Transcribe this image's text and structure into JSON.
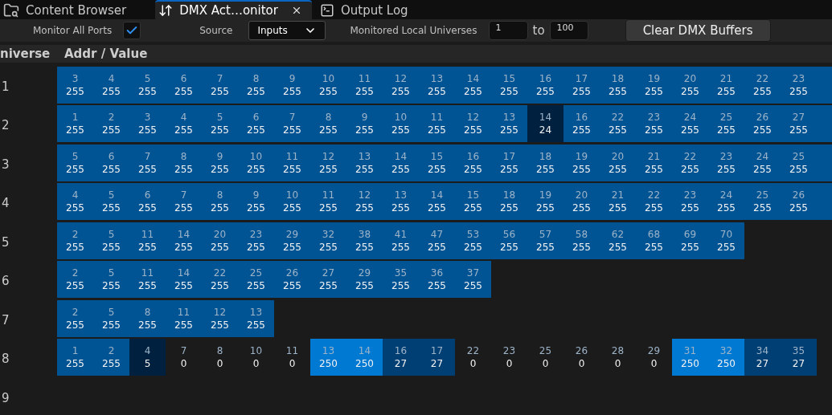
{
  "tabs": [
    {
      "kind": "browser",
      "label": "Content Browser",
      "selected": false,
      "closable": false
    },
    {
      "kind": "monitor",
      "label": "DMX Act…onitor",
      "selected": true,
      "closable": true
    },
    {
      "kind": "log",
      "label": "Output Log",
      "selected": false,
      "closable": false
    }
  ],
  "toolbar": {
    "monitor_all_ports": {
      "label": "Monitor All Ports",
      "checked": true
    },
    "source": {
      "label": "Source",
      "value": "Inputs"
    },
    "universes": {
      "label": "Monitored Local Universes",
      "from": "1",
      "separator": "to",
      "to": "100"
    },
    "clear_button": "Clear DMX Buffers"
  },
  "table": {
    "columns": [
      "niverse",
      "Addr / Value"
    ],
    "rows": [
      {
        "universe": "1",
        "continues": true,
        "cells": [
          {
            "addr": "3",
            "value": "255",
            "color": "#005494"
          },
          {
            "addr": "4",
            "value": "255",
            "color": "#005494"
          },
          {
            "addr": "5",
            "value": "255",
            "color": "#005494"
          },
          {
            "addr": "6",
            "value": "255",
            "color": "#005494"
          },
          {
            "addr": "7",
            "value": "255",
            "color": "#005494"
          },
          {
            "addr": "8",
            "value": "255",
            "color": "#005494"
          },
          {
            "addr": "9",
            "value": "255",
            "color": "#005494"
          },
          {
            "addr": "10",
            "value": "255",
            "color": "#005494"
          },
          {
            "addr": "11",
            "value": "255",
            "color": "#005494"
          },
          {
            "addr": "12",
            "value": "255",
            "color": "#005494"
          },
          {
            "addr": "13",
            "value": "255",
            "color": "#005494"
          },
          {
            "addr": "14",
            "value": "255",
            "color": "#005494"
          },
          {
            "addr": "15",
            "value": "255",
            "color": "#005494"
          },
          {
            "addr": "16",
            "value": "255",
            "color": "#005494"
          },
          {
            "addr": "17",
            "value": "255",
            "color": "#005494"
          },
          {
            "addr": "18",
            "value": "255",
            "color": "#005494"
          },
          {
            "addr": "19",
            "value": "255",
            "color": "#005494"
          },
          {
            "addr": "20",
            "value": "255",
            "color": "#005494"
          },
          {
            "addr": "21",
            "value": "255",
            "color": "#005494"
          },
          {
            "addr": "22",
            "value": "255",
            "color": "#005494"
          },
          {
            "addr": "23",
            "value": "255",
            "color": "#005494"
          }
        ]
      },
      {
        "universe": "2",
        "continues": true,
        "cells": [
          {
            "addr": "1",
            "value": "255",
            "color": "#005494"
          },
          {
            "addr": "2",
            "value": "255",
            "color": "#005494"
          },
          {
            "addr": "3",
            "value": "255",
            "color": "#005494"
          },
          {
            "addr": "4",
            "value": "255",
            "color": "#005494"
          },
          {
            "addr": "5",
            "value": "255",
            "color": "#005494"
          },
          {
            "addr": "6",
            "value": "255",
            "color": "#005494"
          },
          {
            "addr": "7",
            "value": "255",
            "color": "#005494"
          },
          {
            "addr": "8",
            "value": "255",
            "color": "#005494"
          },
          {
            "addr": "9",
            "value": "255",
            "color": "#005494"
          },
          {
            "addr": "10",
            "value": "255",
            "color": "#005494"
          },
          {
            "addr": "11",
            "value": "255",
            "color": "#005494"
          },
          {
            "addr": "12",
            "value": "255",
            "color": "#005494"
          },
          {
            "addr": "13",
            "value": "255",
            "color": "#005494"
          },
          {
            "addr": "14",
            "value": "24",
            "color": "#00203f"
          },
          {
            "addr": "16",
            "value": "255",
            "color": "#005494"
          },
          {
            "addr": "22",
            "value": "255",
            "color": "#005494"
          },
          {
            "addr": "23",
            "value": "255",
            "color": "#005494"
          },
          {
            "addr": "24",
            "value": "255",
            "color": "#005494"
          },
          {
            "addr": "25",
            "value": "255",
            "color": "#005494"
          },
          {
            "addr": "26",
            "value": "255",
            "color": "#005494"
          },
          {
            "addr": "27",
            "value": "255",
            "color": "#005494"
          }
        ]
      },
      {
        "universe": "3",
        "continues": true,
        "cells": [
          {
            "addr": "5",
            "value": "255",
            "color": "#005494"
          },
          {
            "addr": "6",
            "value": "255",
            "color": "#005494"
          },
          {
            "addr": "7",
            "value": "255",
            "color": "#005494"
          },
          {
            "addr": "8",
            "value": "255",
            "color": "#005494"
          },
          {
            "addr": "9",
            "value": "255",
            "color": "#005494"
          },
          {
            "addr": "10",
            "value": "255",
            "color": "#005494"
          },
          {
            "addr": "11",
            "value": "255",
            "color": "#005494"
          },
          {
            "addr": "12",
            "value": "255",
            "color": "#005494"
          },
          {
            "addr": "13",
            "value": "255",
            "color": "#005494"
          },
          {
            "addr": "14",
            "value": "255",
            "color": "#005494"
          },
          {
            "addr": "15",
            "value": "255",
            "color": "#005494"
          },
          {
            "addr": "16",
            "value": "255",
            "color": "#005494"
          },
          {
            "addr": "17",
            "value": "255",
            "color": "#005494"
          },
          {
            "addr": "18",
            "value": "255",
            "color": "#005494"
          },
          {
            "addr": "19",
            "value": "255",
            "color": "#005494"
          },
          {
            "addr": "20",
            "value": "255",
            "color": "#005494"
          },
          {
            "addr": "21",
            "value": "255",
            "color": "#005494"
          },
          {
            "addr": "22",
            "value": "255",
            "color": "#005494"
          },
          {
            "addr": "23",
            "value": "255",
            "color": "#005494"
          },
          {
            "addr": "24",
            "value": "255",
            "color": "#005494"
          },
          {
            "addr": "25",
            "value": "255",
            "color": "#005494"
          }
        ]
      },
      {
        "universe": "4",
        "continues": true,
        "cells": [
          {
            "addr": "4",
            "value": "255",
            "color": "#005494"
          },
          {
            "addr": "5",
            "value": "255",
            "color": "#005494"
          },
          {
            "addr": "6",
            "value": "255",
            "color": "#005494"
          },
          {
            "addr": "7",
            "value": "255",
            "color": "#005494"
          },
          {
            "addr": "8",
            "value": "255",
            "color": "#005494"
          },
          {
            "addr": "9",
            "value": "255",
            "color": "#005494"
          },
          {
            "addr": "10",
            "value": "255",
            "color": "#005494"
          },
          {
            "addr": "11",
            "value": "255",
            "color": "#005494"
          },
          {
            "addr": "12",
            "value": "255",
            "color": "#005494"
          },
          {
            "addr": "13",
            "value": "255",
            "color": "#005494"
          },
          {
            "addr": "14",
            "value": "255",
            "color": "#005494"
          },
          {
            "addr": "15",
            "value": "255",
            "color": "#005494"
          },
          {
            "addr": "18",
            "value": "255",
            "color": "#005494"
          },
          {
            "addr": "19",
            "value": "255",
            "color": "#005494"
          },
          {
            "addr": "20",
            "value": "255",
            "color": "#005494"
          },
          {
            "addr": "21",
            "value": "255",
            "color": "#005494"
          },
          {
            "addr": "22",
            "value": "255",
            "color": "#005494"
          },
          {
            "addr": "23",
            "value": "255",
            "color": "#005494"
          },
          {
            "addr": "24",
            "value": "255",
            "color": "#005494"
          },
          {
            "addr": "25",
            "value": "255",
            "color": "#005494"
          },
          {
            "addr": "26",
            "value": "255",
            "color": "#005494"
          }
        ]
      },
      {
        "universe": "5",
        "continues": false,
        "cells": [
          {
            "addr": "2",
            "value": "255",
            "color": "#005494"
          },
          {
            "addr": "5",
            "value": "255",
            "color": "#005494"
          },
          {
            "addr": "11",
            "value": "255",
            "color": "#005494"
          },
          {
            "addr": "14",
            "value": "255",
            "color": "#005494"
          },
          {
            "addr": "20",
            "value": "255",
            "color": "#005494"
          },
          {
            "addr": "23",
            "value": "255",
            "color": "#005494"
          },
          {
            "addr": "29",
            "value": "255",
            "color": "#005494"
          },
          {
            "addr": "32",
            "value": "255",
            "color": "#005494"
          },
          {
            "addr": "38",
            "value": "255",
            "color": "#005494"
          },
          {
            "addr": "41",
            "value": "255",
            "color": "#005494"
          },
          {
            "addr": "47",
            "value": "255",
            "color": "#005494"
          },
          {
            "addr": "53",
            "value": "255",
            "color": "#005494"
          },
          {
            "addr": "56",
            "value": "255",
            "color": "#005494"
          },
          {
            "addr": "57",
            "value": "255",
            "color": "#005494"
          },
          {
            "addr": "58",
            "value": "255",
            "color": "#005494"
          },
          {
            "addr": "62",
            "value": "255",
            "color": "#005494"
          },
          {
            "addr": "68",
            "value": "255",
            "color": "#005494"
          },
          {
            "addr": "69",
            "value": "255",
            "color": "#005494"
          },
          {
            "addr": "70",
            "value": "255",
            "color": "#005494"
          }
        ]
      },
      {
        "universe": "6",
        "continues": false,
        "cells": [
          {
            "addr": "2",
            "value": "255",
            "color": "#005494"
          },
          {
            "addr": "5",
            "value": "255",
            "color": "#005494"
          },
          {
            "addr": "11",
            "value": "255",
            "color": "#005494"
          },
          {
            "addr": "14",
            "value": "255",
            "color": "#005494"
          },
          {
            "addr": "22",
            "value": "255",
            "color": "#005494"
          },
          {
            "addr": "25",
            "value": "255",
            "color": "#005494"
          },
          {
            "addr": "26",
            "value": "255",
            "color": "#005494"
          },
          {
            "addr": "27",
            "value": "255",
            "color": "#005494"
          },
          {
            "addr": "29",
            "value": "255",
            "color": "#005494"
          },
          {
            "addr": "35",
            "value": "255",
            "color": "#005494"
          },
          {
            "addr": "36",
            "value": "255",
            "color": "#005494"
          },
          {
            "addr": "37",
            "value": "255",
            "color": "#005494"
          }
        ]
      },
      {
        "universe": "7",
        "continues": false,
        "cells": [
          {
            "addr": "2",
            "value": "255",
            "color": "#005494"
          },
          {
            "addr": "5",
            "value": "255",
            "color": "#005494"
          },
          {
            "addr": "8",
            "value": "255",
            "color": "#005494"
          },
          {
            "addr": "11",
            "value": "255",
            "color": "#005494"
          },
          {
            "addr": "12",
            "value": "255",
            "color": "#005494"
          },
          {
            "addr": "13",
            "value": "255",
            "color": "#005494"
          }
        ]
      },
      {
        "universe": "8",
        "continues": false,
        "cells": [
          {
            "addr": "1",
            "value": "255",
            "color": "#005494"
          },
          {
            "addr": "2",
            "value": "255",
            "color": "#005494"
          },
          {
            "addr": "4",
            "value": "5",
            "color": "#00203f"
          },
          {
            "addr": "7",
            "value": "0",
            "color": "#1b1b1b"
          },
          {
            "addr": "8",
            "value": "0",
            "color": "#1b1b1b"
          },
          {
            "addr": "10",
            "value": "0",
            "color": "#1b1b1b"
          },
          {
            "addr": "11",
            "value": "0",
            "color": "#1b1b1b"
          },
          {
            "addr": "13",
            "value": "250",
            "color": "#0079d3"
          },
          {
            "addr": "14",
            "value": "250",
            "color": "#0079d3"
          },
          {
            "addr": "16",
            "value": "27",
            "color": "#003f73"
          },
          {
            "addr": "17",
            "value": "27",
            "color": "#003f73"
          },
          {
            "addr": "22",
            "value": "0",
            "color": "#1b1b1b"
          },
          {
            "addr": "23",
            "value": "0",
            "color": "#1b1b1b"
          },
          {
            "addr": "25",
            "value": "0",
            "color": "#1b1b1b"
          },
          {
            "addr": "26",
            "value": "0",
            "color": "#1b1b1b"
          },
          {
            "addr": "28",
            "value": "0",
            "color": "#1b1b1b"
          },
          {
            "addr": "29",
            "value": "0",
            "color": "#1b1b1b"
          },
          {
            "addr": "31",
            "value": "250",
            "color": "#0079d3"
          },
          {
            "addr": "32",
            "value": "250",
            "color": "#0079d3"
          },
          {
            "addr": "34",
            "value": "27",
            "color": "#003f73"
          },
          {
            "addr": "35",
            "value": "27",
            "color": "#003f73"
          }
        ]
      },
      {
        "universe": "9",
        "continues": false,
        "cells": []
      }
    ]
  }
}
